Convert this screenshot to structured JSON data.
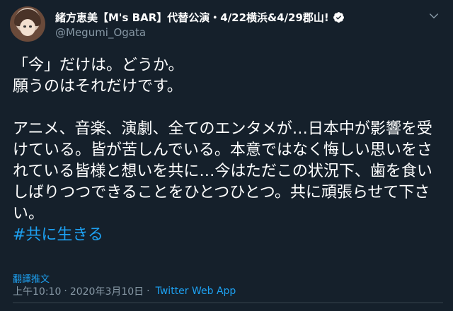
{
  "author": {
    "display_name": "緒方恵美【M's BAR】代替公演・4/22横浜&4/29郡山!",
    "handle": "@Megumi_Ogata",
    "verified": true
  },
  "tweet": {
    "line1": "「今」だけは。どうか。",
    "line2": "願うのはそれだけです。",
    "paragraph": "アニメ、音楽、演劇、全てのエンタメが…日本中が影響を受けている。皆が苦しんでいる。本意ではなく悔しい思いをされている皆様と想いを共に…今はただこの状況下、歯を食いしばりつつできることをひとつひとつ。共に頑張らせて下さい。",
    "hashtag": "#共に生きる"
  },
  "translate_label": "翻譯推文",
  "meta": {
    "time": "上午10:10",
    "date": "2020年3月10日",
    "separator": "·",
    "app": "Twitter Web App"
  },
  "colors": {
    "background": "#15202b",
    "accent": "#1da1f2",
    "muted": "#8899a6"
  },
  "icons": {
    "verified": "verified-badge-icon",
    "caret": "chevron-down-icon"
  }
}
